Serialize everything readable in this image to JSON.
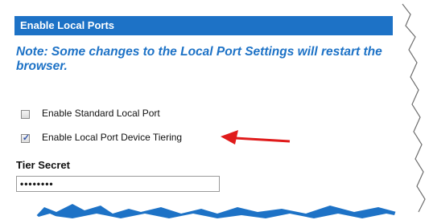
{
  "section": {
    "title": "Enable Local Ports",
    "note": "Note: Some changes to the Local Port Settings will restart the browser."
  },
  "options": [
    {
      "label": "Enable Standard Local Port",
      "checked": false
    },
    {
      "label": "Enable Local Port Device Tiering",
      "checked": true
    }
  ],
  "tier_secret": {
    "label": "Tier Secret",
    "value": "••••••••"
  },
  "colors": {
    "header": "#1d72c6",
    "note": "#1d72c6",
    "arrow": "#e01b1b"
  }
}
